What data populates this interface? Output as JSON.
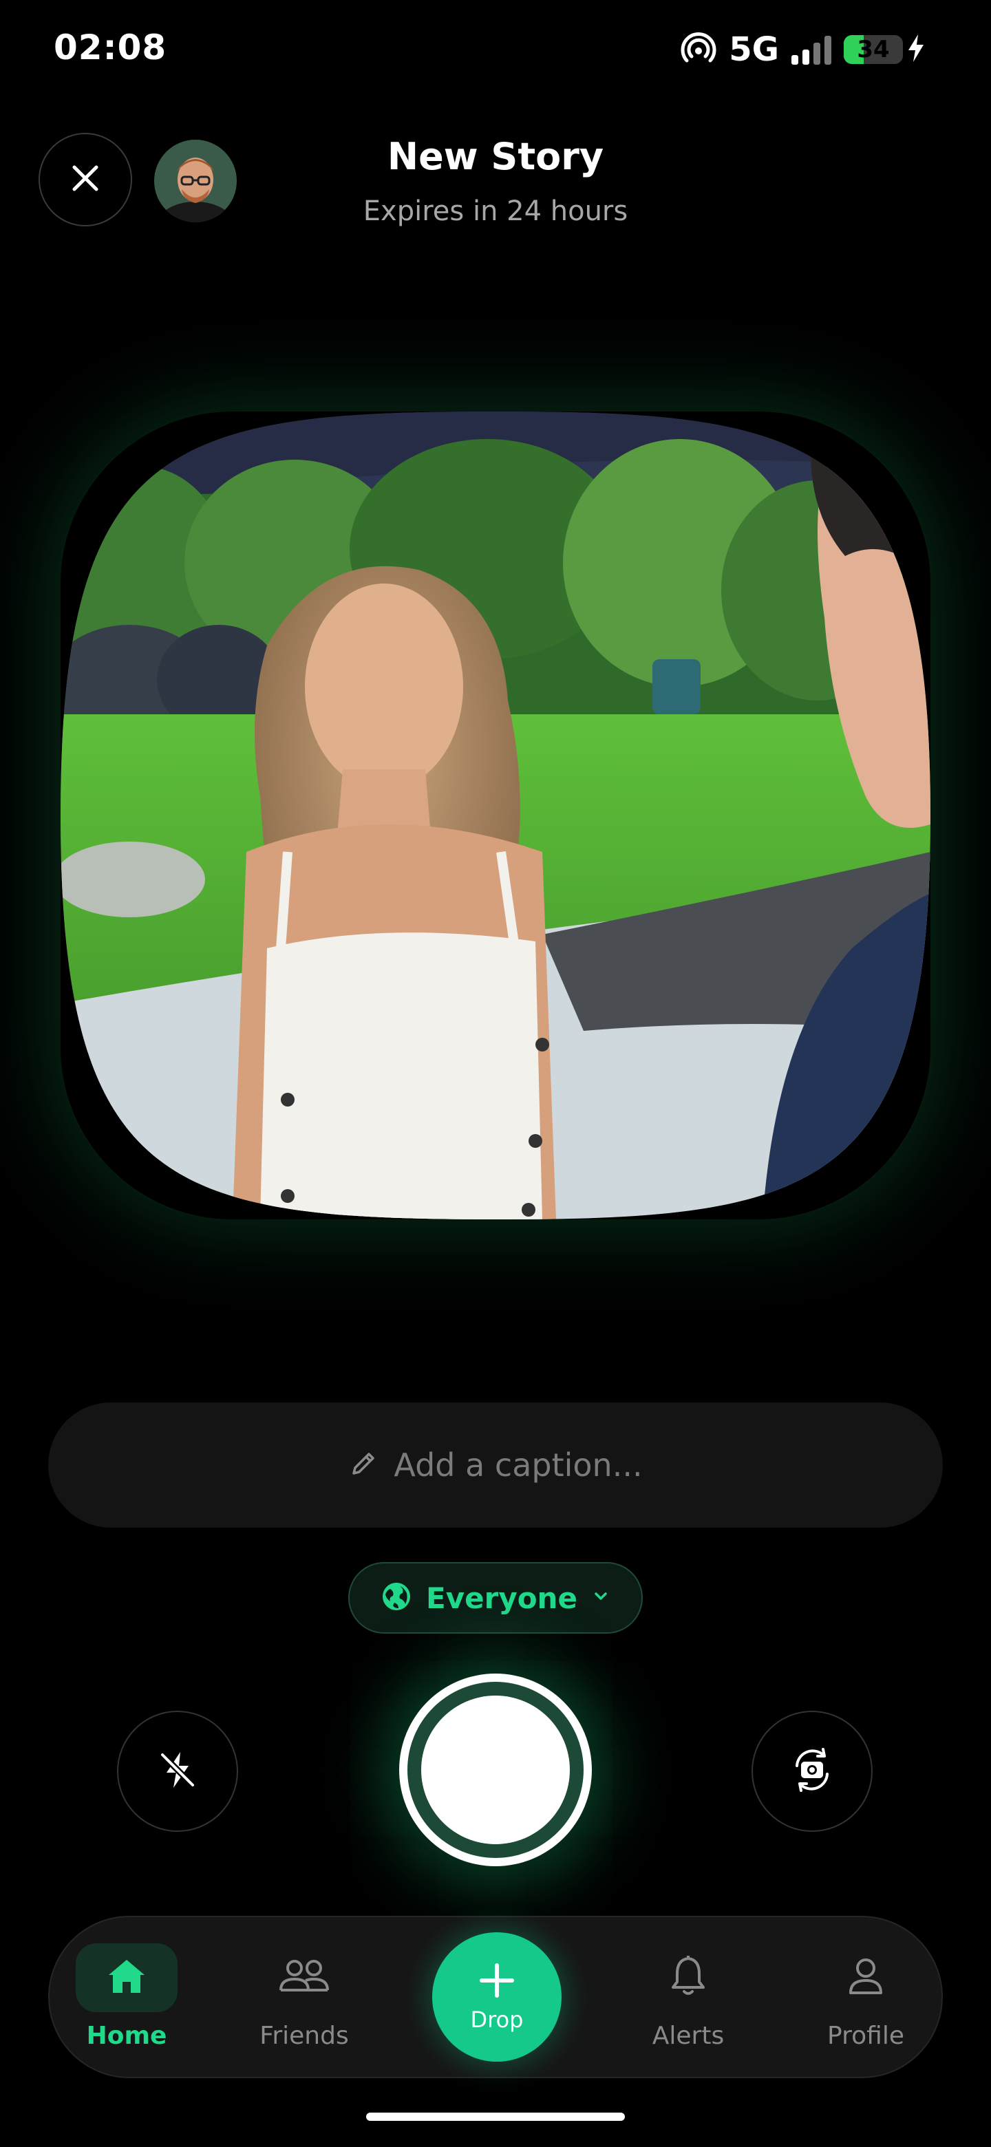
{
  "status_bar": {
    "time": "02:08",
    "network": "5G",
    "battery_level": "34",
    "battery_fraction": 0.34,
    "hotspot_icon": "hotspot-icon",
    "charging_icon": "bolt-icon"
  },
  "header": {
    "title": "New Story",
    "subtitle": "Expires in 24 hours",
    "close_icon": "close-icon",
    "avatar_icon": "user-avatar"
  },
  "caption": {
    "placeholder": "Add a caption...",
    "icon": "pencil-icon"
  },
  "audience": {
    "selected": "Everyone",
    "icon": "globe-icon",
    "dropdown_icon": "chevron-down-icon"
  },
  "controls": {
    "flash_icon": "flash-off-icon",
    "flip_icon": "camera-flip-icon"
  },
  "nav": {
    "items": [
      {
        "label": "Home",
        "icon": "home-icon",
        "active": true
      },
      {
        "label": "Friends",
        "icon": "friends-icon",
        "active": false
      },
      {
        "label": "Drop",
        "icon": "plus-icon",
        "active": false
      },
      {
        "label": "Alerts",
        "icon": "bell-icon",
        "active": false
      },
      {
        "label": "Profile",
        "icon": "profile-icon",
        "active": false
      }
    ]
  },
  "colors": {
    "accent": "#20d98b",
    "drop_button": "#14c98a",
    "background": "#000000",
    "battery": "#2fd158"
  }
}
